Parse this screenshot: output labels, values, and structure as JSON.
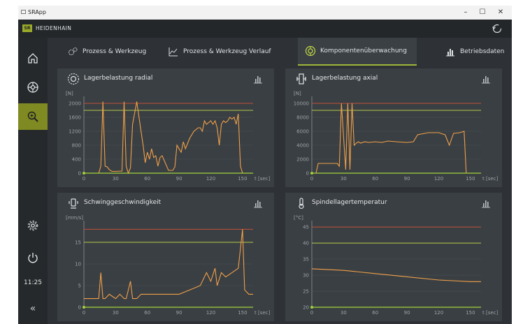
{
  "window": {
    "title": "SRApp",
    "minimize": "–",
    "maximize": "☐",
    "close": "✕"
  },
  "brand": {
    "logo": "SR",
    "name": "HEIDENHAIN"
  },
  "tabs": [
    {
      "label": "Prozess & Werkzeug",
      "icon": "gears-icon",
      "active": false
    },
    {
      "label": "Prozess & Werkzeug Verlauf",
      "icon": "trend-chart-icon",
      "active": false
    },
    {
      "label": "Komponentenüberwachung",
      "icon": "component-monitor-icon",
      "active": true
    },
    {
      "label": "Betriebsdaten",
      "icon": "bar-chart-icon",
      "active": false
    }
  ],
  "sidebar": {
    "items": [
      {
        "name": "home",
        "icon": "home-icon",
        "active": false
      },
      {
        "name": "tool",
        "icon": "tool-wheel-icon",
        "active": false
      },
      {
        "name": "monitor",
        "icon": "zoom-monitor-icon",
        "active": true
      },
      {
        "name": "settings",
        "icon": "gear-icon",
        "active": false
      },
      {
        "name": "power",
        "icon": "power-icon",
        "active": false
      }
    ],
    "clock": "11:25",
    "collapse": "«"
  },
  "colors": {
    "series": "#f0a04a",
    "upper_limit": "#c0503a",
    "warn_limit": "#b7c94a",
    "baseline": "#9fd23a"
  },
  "panels": [
    {
      "title": "Lagerbelastung radial",
      "icon": "bearing-radial-icon",
      "chart_data": {
        "type": "line",
        "title": "Lagerbelastung radial",
        "ylabel": "[N]",
        "xlabel": "t [sec]",
        "xlim": [
          0,
          160
        ],
        "ylim": [
          0,
          2200
        ],
        "xticks": [
          0,
          30,
          60,
          90,
          120,
          150
        ],
        "yticks": [
          0,
          400,
          800,
          1200,
          1600,
          2000
        ],
        "limits": {
          "upper": 2000,
          "warn": 1800
        },
        "series": [
          {
            "x": [
              0,
              14,
              16,
              18,
              20,
              22,
              24,
              26,
              28,
              36,
              38,
              40,
              42,
              44,
              46,
              50,
              54,
              56,
              58,
              60,
              62,
              64,
              66,
              68,
              70,
              72,
              74,
              80,
              84,
              86,
              88,
              92,
              94,
              96,
              100,
              104,
              108,
              110,
              112,
              114,
              116,
              118,
              120,
              122,
              124,
              126,
              128,
              130,
              132,
              134,
              136,
              138,
              140,
              142,
              144,
              146,
              148,
              150,
              152
            ],
            "y": [
              0,
              0,
              200,
              2050,
              200,
              180,
              100,
              60,
              50,
              60,
              2050,
              200,
              0,
              150,
              1400,
              2050,
              1200,
              800,
              300,
              600,
              400,
              700,
              450,
              500,
              200,
              450,
              500,
              80,
              80,
              180,
              800,
              600,
              900,
              700,
              1000,
              1200,
              1300,
              1300,
              1200,
              1500,
              1400,
              1450,
              1500,
              1400,
              1500,
              1300,
              800,
              1400,
              1500,
              1450,
              1500,
              1600,
              1550,
              1600,
              1400,
              1700,
              200,
              0,
              0
            ]
          }
        ]
      }
    },
    {
      "title": "Lagerbelastung axial",
      "icon": "bearing-axial-icon",
      "chart_data": {
        "type": "line",
        "title": "Lagerbelastung axial",
        "ylabel": "[N]",
        "xlabel": "t [sec]",
        "xlim": [
          0,
          160
        ],
        "ylim": [
          0,
          11000
        ],
        "xticks": [
          0,
          30,
          60,
          90,
          120,
          150
        ],
        "yticks": [
          0,
          2000,
          4000,
          6000,
          8000,
          10000
        ],
        "limits": {
          "upper": 10000,
          "warn": 9000
        },
        "series": [
          {
            "x": [
              0,
              4,
              6,
              10,
              14,
              20,
              24,
              26,
              28,
              32,
              34,
              36,
              38,
              40,
              42,
              44,
              46,
              50,
              54,
              60,
              66,
              72,
              80,
              90,
              96,
              100,
              110,
              120,
              126,
              130,
              134,
              140,
              144,
              146,
              150,
              156,
              160
            ],
            "y": [
              0,
              0,
              1400,
              1400,
              1400,
              1400,
              1400,
              1000,
              10000,
              500,
              10000,
              500,
              10000,
              4000,
              4300,
              4500,
              4300,
              4500,
              4400,
              4500,
              4400,
              4600,
              4500,
              4400,
              4500,
              5500,
              5800,
              5800,
              5500,
              4000,
              5700,
              5800,
              6000,
              0,
              0,
              0,
              0
            ]
          }
        ]
      }
    },
    {
      "title": "Schwinggeschwindigkeit",
      "icon": "vibration-icon",
      "chart_data": {
        "type": "line",
        "title": "Schwinggeschwindigkeit",
        "ylabel": "[mm/s]",
        "xlabel": "t [sec]",
        "xlim": [
          0,
          160
        ],
        "ylim": [
          0,
          20
        ],
        "xticks": [
          0,
          30,
          60,
          90,
          120,
          150
        ],
        "yticks": [
          0,
          5,
          10,
          15
        ],
        "limits": {
          "upper": 18,
          "warn": 15
        },
        "series": [
          {
            "x": [
              0,
              10,
              14,
              16,
              18,
              20,
              24,
              30,
              34,
              38,
              40,
              44,
              46,
              50,
              54,
              60,
              70,
              80,
              90,
              100,
              110,
              116,
              120,
              124,
              126,
              130,
              134,
              140,
              146,
              150,
              152,
              156,
              160
            ],
            "y": [
              2,
              2,
              2,
              8,
              2,
              2,
              3,
              2,
              3,
              2,
              2,
              6,
              2,
              2,
              3,
              3,
              3,
              3,
              3,
              4,
              5,
              8,
              6,
              9,
              5,
              8,
              7,
              8,
              9,
              18,
              4,
              3,
              3
            ]
          }
        ]
      }
    },
    {
      "title": "Spindellagertemperatur",
      "icon": "thermometer-icon",
      "chart_data": {
        "type": "line",
        "title": "Spindellagertemperatur",
        "ylabel": "[°C]",
        "xlabel": "t [sec]",
        "xlim": [
          0,
          160
        ],
        "ylim": [
          20,
          47
        ],
        "xticks": [
          0,
          30,
          60,
          90,
          120,
          150
        ],
        "yticks": [
          20,
          25,
          30,
          35,
          40,
          45
        ],
        "limits": {
          "upper": 45,
          "warn": 40
        },
        "series": [
          {
            "x": [
              0,
              30,
              60,
              90,
              120,
              150,
              160
            ],
            "y": [
              32,
              31.5,
              30.5,
              29.5,
              28.5,
              28,
              28
            ]
          }
        ]
      }
    }
  ]
}
